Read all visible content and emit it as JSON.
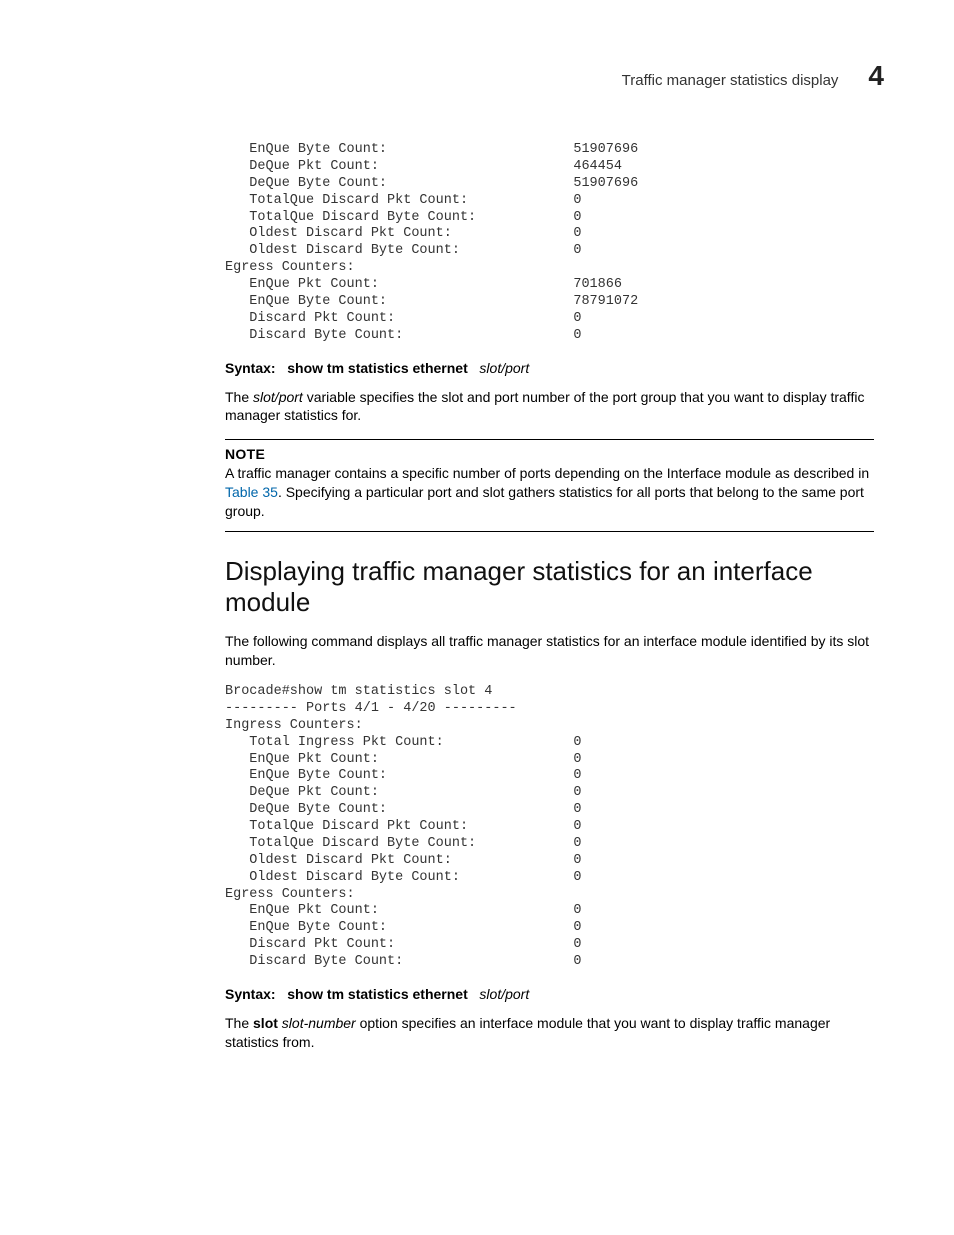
{
  "header": {
    "title": "Traffic manager statistics display",
    "chapter": "4"
  },
  "pre1": "   EnQue Byte Count:                       51907696\n   DeQue Pkt Count:                        464454\n   DeQue Byte Count:                       51907696\n   TotalQue Discard Pkt Count:             0\n   TotalQue Discard Byte Count:            0\n   Oldest Discard Pkt Count:               0\n   Oldest Discard Byte Count:              0\nEgress Counters:\n   EnQue Pkt Count:                        701866\n   EnQue Byte Count:                       78791072\n   Discard Pkt Count:                      0\n   Discard Byte Count:                     0",
  "syntax1": {
    "label": "Syntax:",
    "cmd": "show tm statistics ethernet",
    "arg": "slot/port"
  },
  "para1": {
    "pre": "The ",
    "italic": "slot/port",
    "post": " variable specifies the slot and port number of the port group that you want to display traffic manager statistics for."
  },
  "note": {
    "label": "NOTE",
    "pre": "A traffic manager contains a specific number of ports depending on the Interface module as described in ",
    "link": "Table 35",
    "post": ". Specifying a particular port and slot gathers statistics for all ports that belong to the same port group."
  },
  "section_heading": "Displaying traffic manager statistics for an interface module",
  "para2": "The following command displays all traffic manager statistics for an interface module identified by its slot number.",
  "pre2": "Brocade#show tm statistics slot 4\n--------- Ports 4/1 - 4/20 ---------\nIngress Counters:\n   Total Ingress Pkt Count:                0\n   EnQue Pkt Count:                        0\n   EnQue Byte Count:                       0\n   DeQue Pkt Count:                        0\n   DeQue Byte Count:                       0\n   TotalQue Discard Pkt Count:             0\n   TotalQue Discard Byte Count:            0\n   Oldest Discard Pkt Count:               0\n   Oldest Discard Byte Count:              0\nEgress Counters:\n   EnQue Pkt Count:                        0\n   EnQue Byte Count:                       0\n   Discard Pkt Count:                      0\n   Discard Byte Count:                     0",
  "syntax2": {
    "label": "Syntax:",
    "cmd": "show tm statistics ethernet",
    "arg": "slot/port"
  },
  "para3": {
    "pre": "The ",
    "bold": "slot",
    "mid": " ",
    "italic": "slot-number",
    "post": " option specifies an interface module that you want to display traffic manager statistics from."
  }
}
